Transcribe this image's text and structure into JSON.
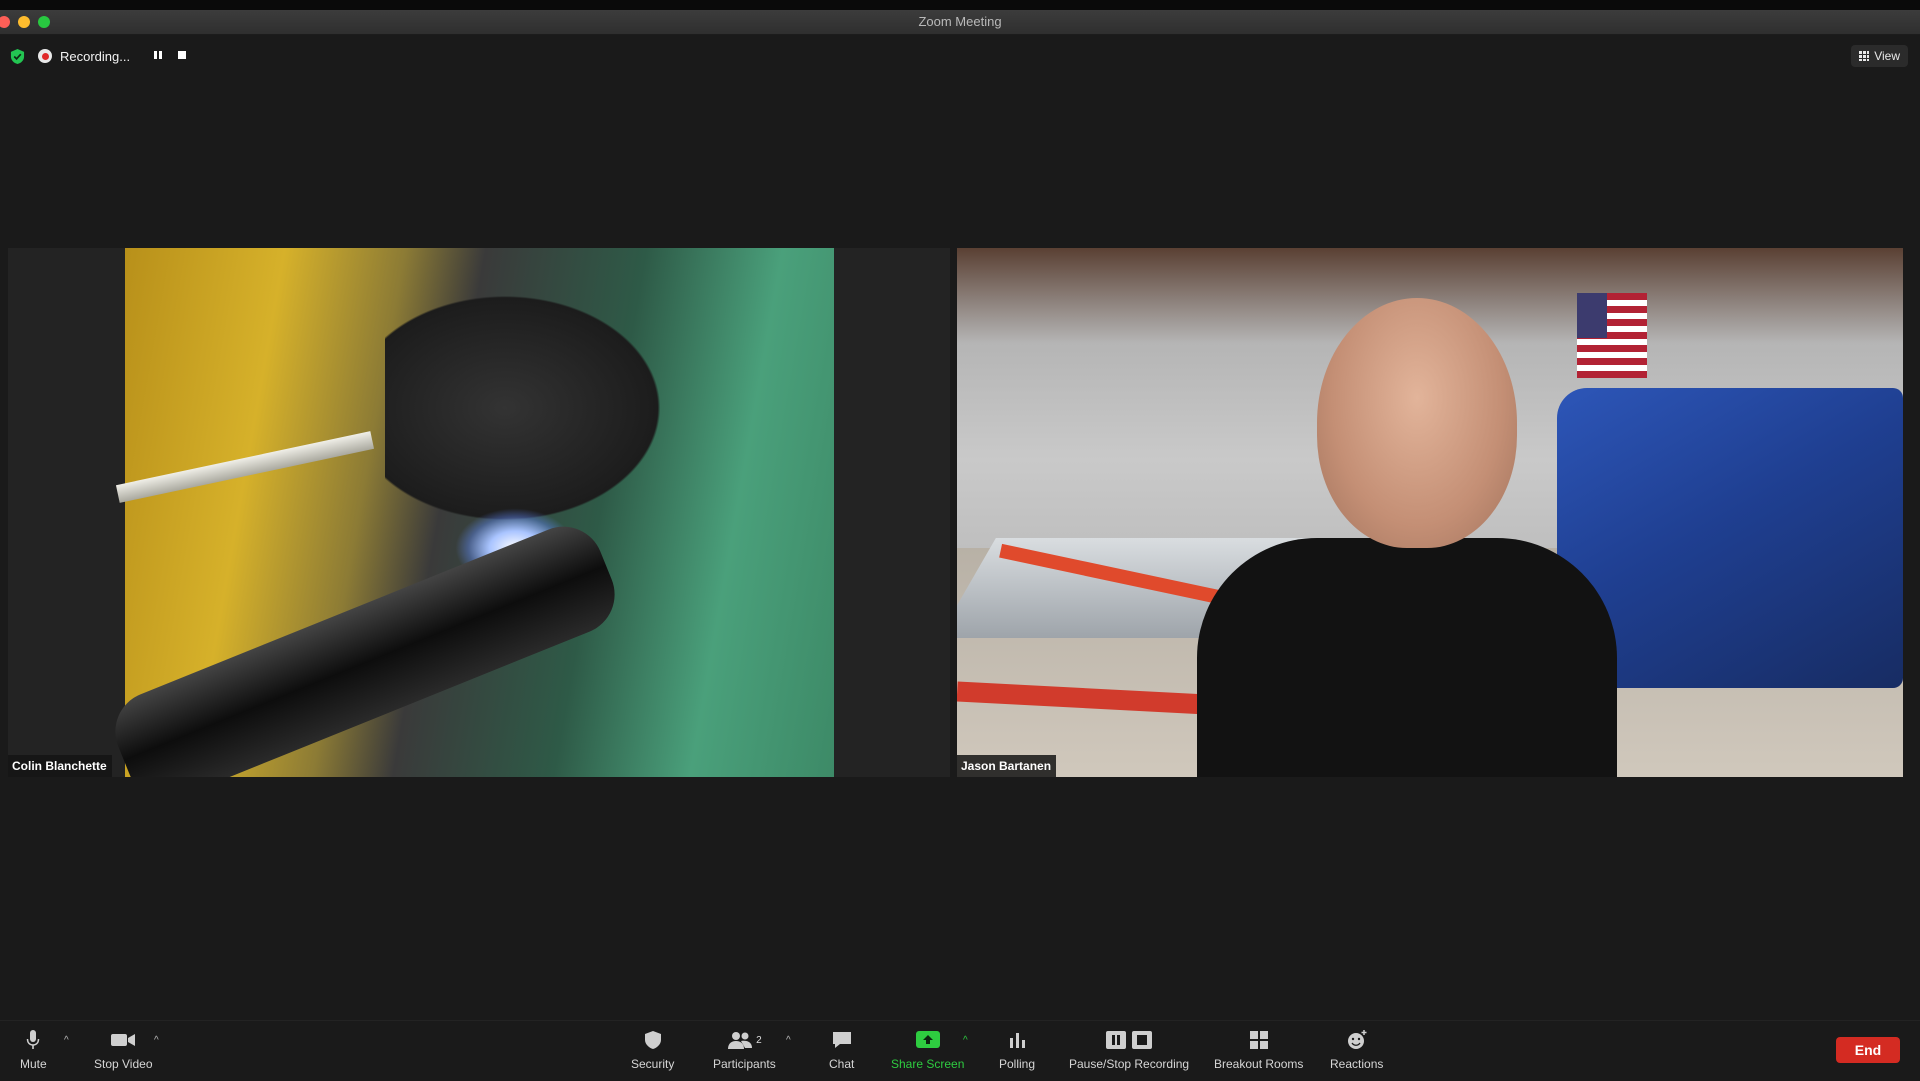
{
  "window": {
    "title": "Zoom Meeting"
  },
  "recording": {
    "label": "Recording...",
    "pause_icon": "pause-icon",
    "stop_icon": "stop-icon"
  },
  "view": {
    "label": "View"
  },
  "participants_tiles": [
    {
      "name": "Colin Blanchette"
    },
    {
      "name": "Jason Bartanen"
    }
  ],
  "toolbar": {
    "mute": "Mute",
    "stop_video": "Stop Video",
    "security": "Security",
    "participants": "Participants",
    "participants_count": "2",
    "chat": "Chat",
    "share_screen": "Share Screen",
    "polling": "Polling",
    "pause_stop_recording": "Pause/Stop Recording",
    "breakout_rooms": "Breakout Rooms",
    "reactions": "Reactions",
    "end": "End"
  },
  "colors": {
    "share_green": "#2ecc40",
    "end_red": "#d42b22",
    "shield_green": "#23c552"
  }
}
